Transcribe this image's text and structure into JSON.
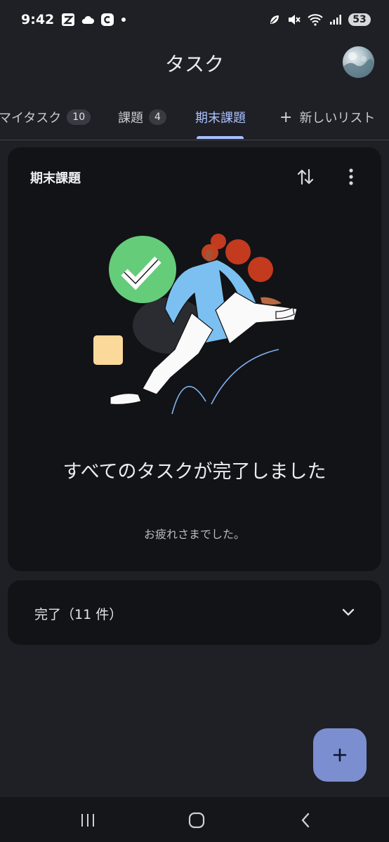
{
  "status_bar": {
    "time": "9:42",
    "battery": "53",
    "left_icons": [
      "z-app-icon",
      "cloud-icon",
      "c-app-icon",
      "dot-icon"
    ],
    "right_icons": [
      "leaf-icon",
      "mute-icon",
      "wifi-icon",
      "signal-icon"
    ]
  },
  "app_bar": {
    "title": "タスク"
  },
  "tabs": [
    {
      "label": "マイタスク",
      "count": "10",
      "active": false
    },
    {
      "label": "課題",
      "count": "4",
      "active": false
    },
    {
      "label": "期末課題",
      "count": "",
      "active": true
    },
    {
      "label": "新しいリスト",
      "count": "",
      "active": false,
      "icon": "plus-icon"
    }
  ],
  "card": {
    "title": "期末課題",
    "empty_title": "すべてのタスクが完了しました",
    "empty_subtitle": "お疲れさまでした。"
  },
  "completed": {
    "label": "完了（11 件）"
  },
  "colors": {
    "background": "#1f2025",
    "card": "#121317",
    "accent": "#a9c1ff",
    "fab": "#7b8fd0"
  }
}
